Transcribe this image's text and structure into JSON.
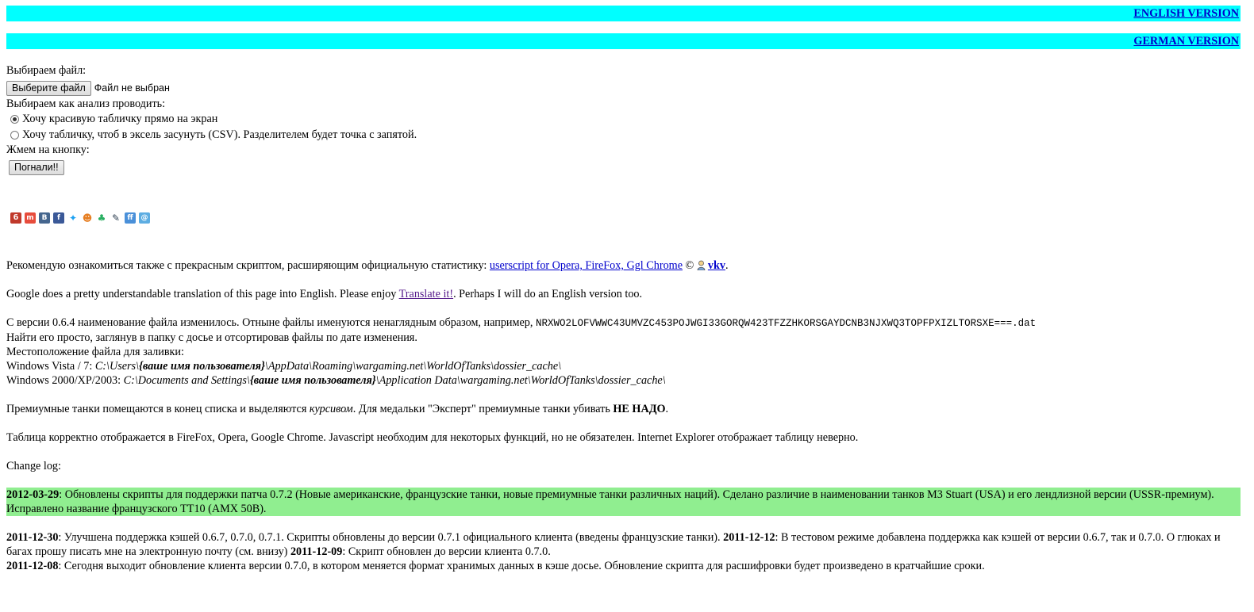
{
  "nav": {
    "english": "ENGLISH VERSION",
    "german": "GERMAN VERSION"
  },
  "form": {
    "choose_file_label": "Выбираем файл:",
    "file_button": "Выберите файл",
    "file_status": "Файл не выбран",
    "analysis_label": "Выбираем как анализ проводить:",
    "option_table": "Хочу красивую табличку прямо на экран",
    "option_csv": "Хочу табличку, чтоб в эксель засунуть (CSV). Разделителем будет точка с запятой.",
    "press_label": "Жмем на кнопку:",
    "go_button": "Погнали!!"
  },
  "share_icons": [
    "bobrdobr-icon",
    "memori-icon",
    "vkontakte-icon",
    "facebook-icon",
    "twitter-icon",
    "people-icon",
    "friends-icon",
    "bookmark-icon",
    "friendfeed-icon",
    "mail-icon"
  ],
  "recommend": {
    "text": "Рекомендую ознакомиться также с прекрасным скриптом, расширяющим официальную статистику: ",
    "link": "userscript for Opera, FireFox, Ggl Chrome",
    "copy": " © ",
    "author": "vkv",
    "end": "."
  },
  "translate": {
    "text": "Google does a pretty understandable translation of this page into English. Please enjoy ",
    "link": "Translate it!",
    "end": ". Perhaps I will do an English version too."
  },
  "info": {
    "version_text": "С версии 0.6.4 наименование файла изменилось. Отныне файлы именуются ненаглядным образом, например, ",
    "example_file": "NRXWO2LOFVWWC43UMVZC453POJWGI33GORQW423TFZZHKORSGAYDCNB3NJXWQ3TOPFPXIZLTORSXE===.dat",
    "find_text": "Найти его просто, заглянув в папку с досье и отсортировав файлы по дате изменения.",
    "location_label": "Местоположение файла для заливки:",
    "vista_label": "Windows Vista / 7: ",
    "vista_path_a": "C:\\Users\\",
    "vista_user": "{ваше имя пользователя}",
    "vista_path_b": "\\AppData\\Roaming\\wargaming.net\\WorldOfTanks\\dossier_cache\\",
    "xp_label": "Windows 2000/XP/2003: ",
    "xp_path_a": "C:\\Documents and Settings\\",
    "xp_user": "{ваше имя пользователя}",
    "xp_path_b": "\\Application Data\\wargaming.net\\WorldOfTanks\\dossier_cache\\"
  },
  "premium": {
    "text_a": "Премиумные танки помещаются в конец списка и выделяются ",
    "italic": "курсивом",
    "text_b": ". Для медальки \"Эксперт\" премиумные танки убивать ",
    "bold": "НЕ НАДО",
    "end": "."
  },
  "browsers": "Таблица корректно отображается в FireFox, Opera, Google Chrome. Javascript необходим для некоторых функций, но не обязателен. Internet Explorer отображает таблицу неверно.",
  "changelog": {
    "title": "Change log:",
    "entry1_date": "2012-03-29",
    "entry1_text": ": Обновлены скрипты для поддержки патча 0.7.2 (Новые американские, французские танки, новые премиумные танки различных наций). Сделано различие в наименовании танков M3 Stuart (USA) и его лендлизной версии (USSR-премиум). Исправлено название французского ТТ10 (AMX 50B).",
    "entry2_date": "2011-12-30",
    "entry2_text": ": Улучшена поддержка кэшей 0.6.7, 0.7.0, 0.7.1. Скрипты обновлены до версии 0.7.1 официального клиента (введены французские танки). ",
    "entry3_date": "2011-12-12",
    "entry3_text": ": В тестовом режиме добавлена поддержка как кэшей от версии 0.6.7, так и 0.7.0. О глюках и багах прошу писать мне на электронную почту (см. внизу) ",
    "entry4_date": "2011-12-09",
    "entry4_text": ": Скрипт обновлен до версии клиента 0.7.0.",
    "entry5_date": "2011-12-08",
    "entry5_text": ": Сегодня выходит обновление клиента версии 0.7.0, в котором меняется формат хранимых данных в кэше досье. Обновление скрипта для расшифровки будет произведено в кратчайшие сроки."
  },
  "colors": {
    "nav_bar": "#00ffff",
    "highlight": "#90ee90",
    "link": "#0000cc",
    "visited": "#551a8b"
  }
}
